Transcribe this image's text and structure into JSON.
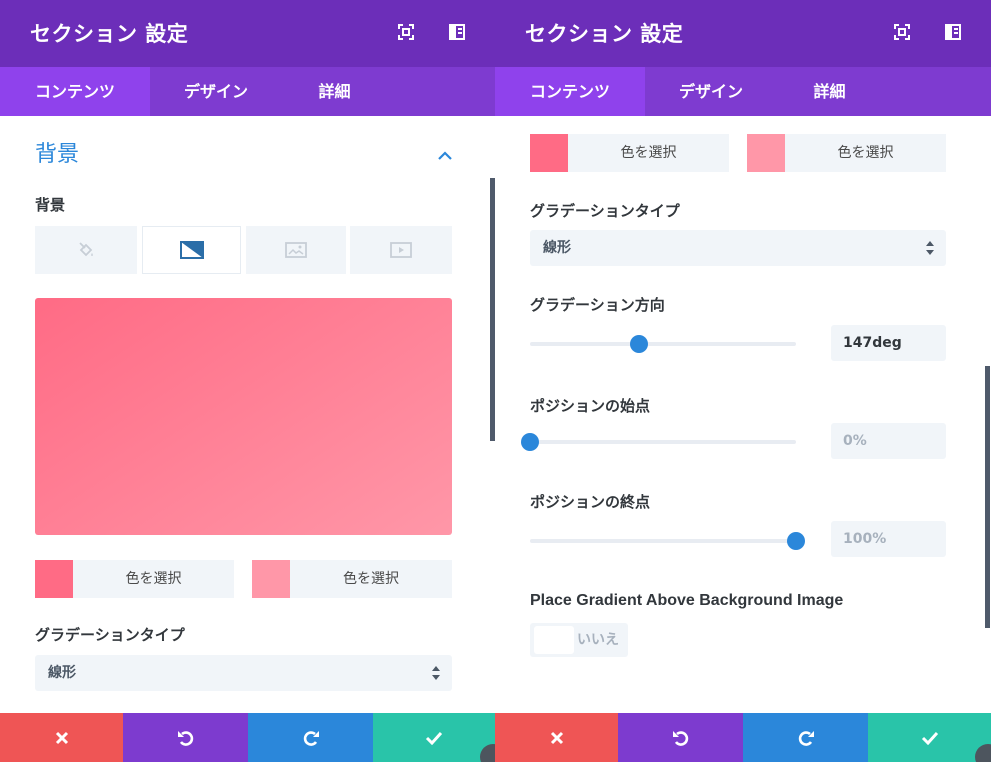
{
  "header": {
    "title": "セクション 設定"
  },
  "tabs": [
    {
      "label": "コンテンツ"
    },
    {
      "label": "デザイン"
    },
    {
      "label": "詳細"
    }
  ],
  "background_section": {
    "title": "背景",
    "field_label": "背景",
    "background_types": [
      "color-fill-icon",
      "gradient-icon",
      "image-icon",
      "video-icon"
    ],
    "active_type_index": 1
  },
  "gradient": {
    "start_color": "#ff6b85",
    "end_color": "#ff97a8",
    "color_pick_label": "色を選択",
    "type_label": "グラデーションタイプ",
    "type_value": "線形",
    "direction_label": "グラデーション方向",
    "direction_value": "147deg",
    "direction_fraction": 0.41,
    "start_position_label": "ポジションの始点",
    "start_position_value": "0%",
    "start_position_fraction": 0.0,
    "end_position_label": "ポジションの終点",
    "end_position_value": "100%",
    "end_position_fraction": 1.0,
    "above_image_label": "Place Gradient Above Background Image",
    "above_image_value": "いいえ"
  },
  "footer": {
    "buttons": [
      "close-icon",
      "undo-icon",
      "redo-icon",
      "check-icon"
    ]
  },
  "colors": {
    "titlebar": "#6c2eb9",
    "tabbar": "#7e3bd0",
    "tab_active": "#8f42ec",
    "accent_blue": "#2b87da",
    "cancel": "#ef5555",
    "undo": "#7d3bcf",
    "redo": "#2b87da",
    "save": "#29c4a9"
  }
}
